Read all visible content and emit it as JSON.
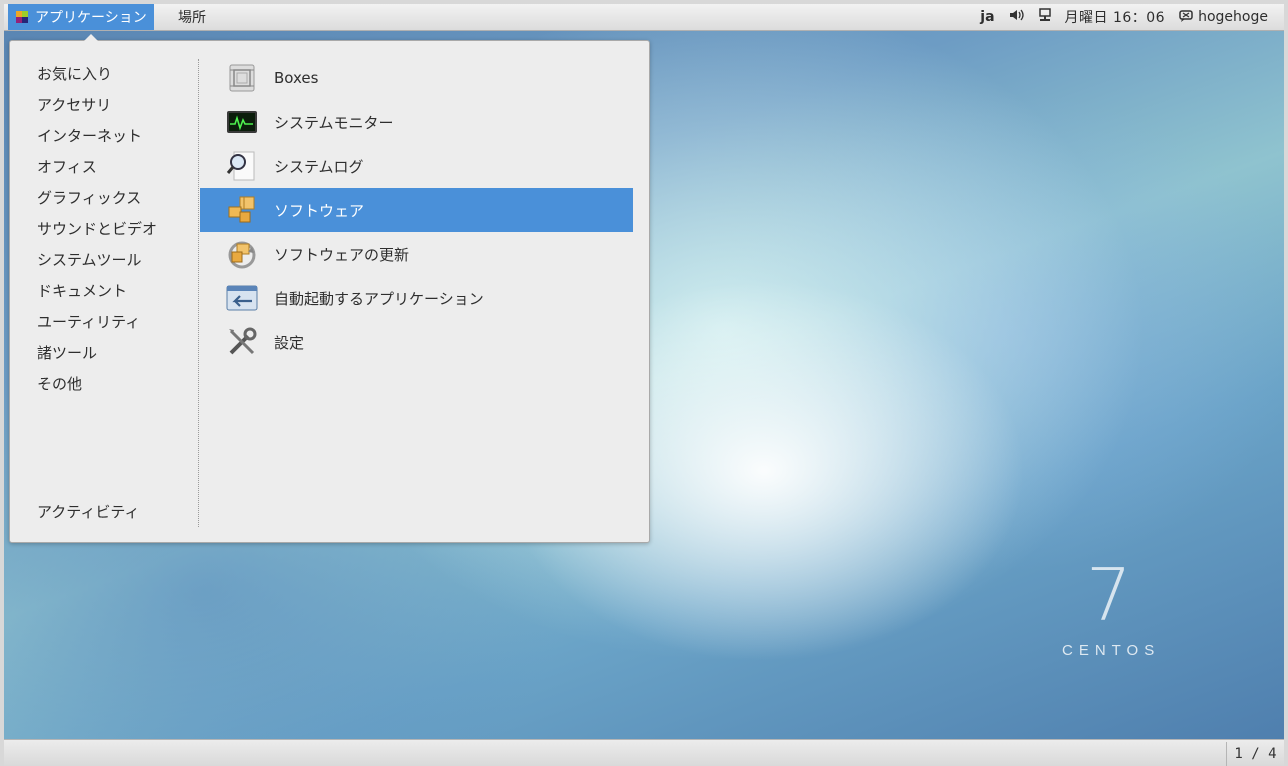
{
  "top_panel": {
    "applications_label": "アプリケーション",
    "places_label": "場所",
    "input_method": "ja",
    "clock": "月曜日 16：06",
    "user_name": "hogehoge"
  },
  "menu": {
    "categories": [
      "お気に入り",
      "アクセサリ",
      "インターネット",
      "オフィス",
      "グラフィックス",
      "サウンドとビデオ",
      "システムツール",
      "ドキュメント",
      "ユーティリティ",
      "諸ツール",
      "その他"
    ],
    "activities_label": "アクティビティ",
    "apps": [
      {
        "label": "Boxes",
        "icon": "boxes-icon"
      },
      {
        "label": "システムモニター",
        "icon": "system-monitor-icon"
      },
      {
        "label": "システムログ",
        "icon": "system-log-icon"
      },
      {
        "label": "ソフトウェア",
        "icon": "software-icon"
      },
      {
        "label": "ソフトウェアの更新",
        "icon": "software-update-icon"
      },
      {
        "label": "自動起動するアプリケーション",
        "icon": "startup-apps-icon"
      },
      {
        "label": "設定",
        "icon": "settings-icon"
      }
    ]
  },
  "desktop": {
    "logo_number": "7",
    "logo_word": "CENTOS"
  },
  "bottom_panel": {
    "workspace_indicator": "1 / 4"
  },
  "colors": {
    "accent": "#4a90d9",
    "menu_bg": "#ededed"
  }
}
